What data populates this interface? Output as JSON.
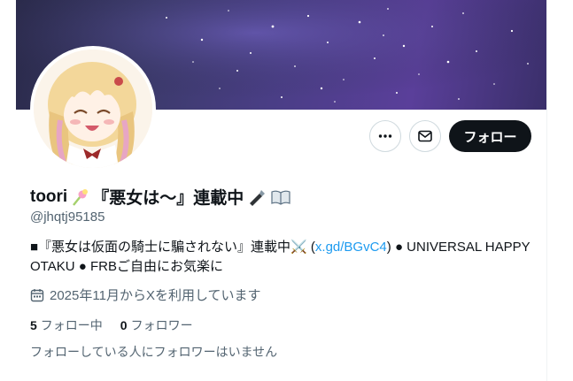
{
  "profile": {
    "display_name": "toori",
    "name_suffix": "『悪女は〜』連載中",
    "handle": "@jhqtj95185",
    "bio_prefix": "■『悪女は仮面の騎士に騙されない』連載中⚔️ (",
    "bio_link": "x.gd/BGvC4",
    "bio_suffix": ") ● UNIVERSAL HAPPY OTAKU ● FRBご自由にお気楽に",
    "joined": "2025年11月からXを利用しています",
    "following_count": "5",
    "following_label": "フォロー中",
    "followers_count": "0",
    "followers_label": "フォロワー",
    "followers_note": "フォローしている人にフォロワーはいません"
  },
  "actions": {
    "follow_label": "フォロー"
  },
  "icons": {
    "more": "more-icon",
    "mail": "mail-icon",
    "calendar": "calendar-icon",
    "candy": "candy-emoji",
    "pen": "pen-emoji",
    "book": "book-emoji"
  }
}
